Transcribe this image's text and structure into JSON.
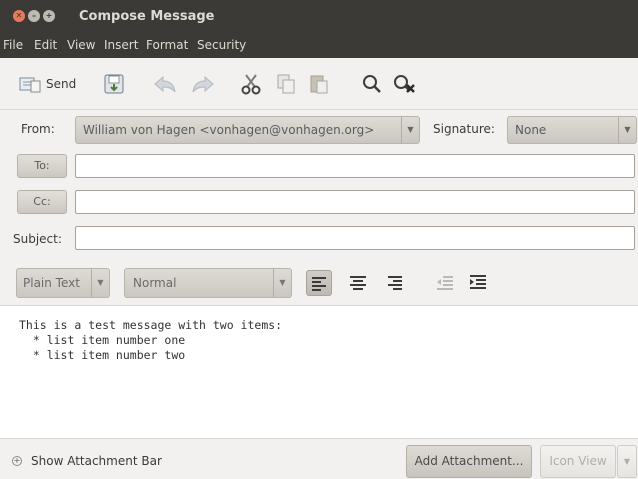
{
  "window": {
    "title": "Compose Message"
  },
  "menu": [
    "File",
    "Edit",
    "View",
    "Insert",
    "Format",
    "Security"
  ],
  "toolbar": {
    "send_label": "Send",
    "icons": [
      "send-icon",
      "save-icon",
      "reply-icon",
      "forward-icon",
      "cut-icon",
      "copy-icon",
      "paste-icon",
      "find-icon",
      "spellcheck-icon"
    ]
  },
  "header": {
    "from_label": "From:",
    "from_value": "William von Hagen <vonhagen@vonhagen.org>",
    "signature_label": "Signature:",
    "signature_value": "None",
    "to_button": "To:",
    "to_value": "",
    "cc_button": "Cc:",
    "cc_value": "",
    "subject_label": "Subject:",
    "subject_value": ""
  },
  "format": {
    "mode": "Plain Text",
    "paragraph_style": "Normal"
  },
  "message": {
    "body": "This is a test message with two items:\n  * list item number one\n  * list item number two"
  },
  "bottom": {
    "show_attachment_bar": "Show Attachment Bar",
    "add_attachment": "Add Attachment...",
    "view_mode": "Icon View"
  },
  "colors": {
    "chrome": "#3b3a36",
    "panel": "#f2f1f0",
    "close_button": "#e87a5a"
  }
}
